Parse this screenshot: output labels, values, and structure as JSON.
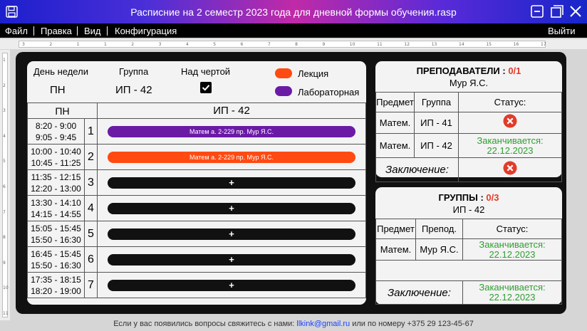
{
  "window": {
    "title": "Расписние на 2 семестр 2023 года для дневной формы обучения.rasp"
  },
  "menu": {
    "file": "Файл",
    "edit": "Правка",
    "view": "Вид",
    "config": "Конфигурация",
    "exit": "Выйти"
  },
  "ruler": {
    "top_ticks": [
      "3",
      "2",
      "1",
      "1",
      "2",
      "3",
      "4",
      "5",
      "6",
      "7",
      "8",
      "9",
      "10",
      "11",
      "12",
      "13",
      "14",
      "15",
      "16",
      "17"
    ],
    "left_ticks": [
      "1",
      "2",
      "3",
      "4",
      "5",
      "6",
      "7",
      "8",
      "9",
      "10",
      "11"
    ]
  },
  "schedule": {
    "day_label": "День недели",
    "day_value": "ПН",
    "group_label": "Группа",
    "group_value": "ИП - 42",
    "above_line_label": "Над чертой",
    "above_line_checked": true,
    "legend": [
      {
        "label": "Лекция",
        "color": "#ff4a12"
      },
      {
        "label": "Лабораторная",
        "color": "#6b1aa6"
      }
    ],
    "col_day": "ПН",
    "col_group": "ИП - 42",
    "rows": [
      {
        "t1": "8:20 - 9:00",
        "t2": "9:05 - 9:45",
        "n": "1",
        "text": "Матем а. 2-229 пр. Мур Я.С.",
        "color": "#6b1aa6"
      },
      {
        "t1": "10:00 - 10:40",
        "t2": "10:45 - 11:25",
        "n": "2",
        "text": "Матем а. 2-229 пр. Мур Я.С.",
        "color": "#ff4a12"
      },
      {
        "t1": "11:35 - 12:15",
        "t2": "12:20 - 13:00",
        "n": "3",
        "text": "+",
        "color": "#111111"
      },
      {
        "t1": "13:30 - 14:10",
        "t2": "14:15 - 14:55",
        "n": "4",
        "text": "+",
        "color": "#111111"
      },
      {
        "t1": "15:05 - 15:45",
        "t2": "15:50 - 16:30",
        "n": "5",
        "text": "+",
        "color": "#111111"
      },
      {
        "t1": "16:45 - 15:45",
        "t2": "15:50 - 16:30",
        "n": "6",
        "text": "+",
        "color": "#111111"
      },
      {
        "t1": "17:35 - 18:15",
        "t2": "18:20 - 19:00",
        "n": "7",
        "text": "+",
        "color": "#111111"
      }
    ]
  },
  "teachers": {
    "title": "ПРЕПОДАВАТЕЛИ :",
    "count": "0/1",
    "name": "Мур Я.С.",
    "headers": [
      "Предмет",
      "Группа",
      "Статус:"
    ],
    "rows": [
      {
        "subject": "Матем.",
        "group": "ИП - 41",
        "status_icon": "error-x",
        "status_text": ""
      },
      {
        "subject": "Матем.",
        "group": "ИП - 42",
        "status_icon": "",
        "status_text": "Заканчивается: 22.12.2023"
      }
    ],
    "conclusion_label": "Заключение:",
    "conclusion_icon": "error-x"
  },
  "groups": {
    "title": "ГРУППЫ :",
    "count": "0/3",
    "name": "ИП - 42",
    "headers": [
      "Предмет",
      "Препод.",
      "Статус:"
    ],
    "rows": [
      {
        "subject": "Матем.",
        "teacher": "Мур Я.С.",
        "status_text": "Заканчивается: 22.12.2023"
      }
    ],
    "conclusion_label": "Заключение:",
    "conclusion_status": "Заканчивается: 22.12.2023"
  },
  "footer": {
    "prefix": "Если у вас появились вопросы свяжитесь с нами:",
    "email": "llkink@gmail.ru",
    "suffix": "или по номеру +375 29 123-45-67"
  },
  "colors": {
    "title_gradient": [
      "#1c1fcc",
      "#c02aa7",
      "#1626c9"
    ],
    "lecture": "#ff4a12",
    "lab": "#6b1aa6",
    "error": "#e23b2a",
    "ok": "#2f9e30"
  }
}
